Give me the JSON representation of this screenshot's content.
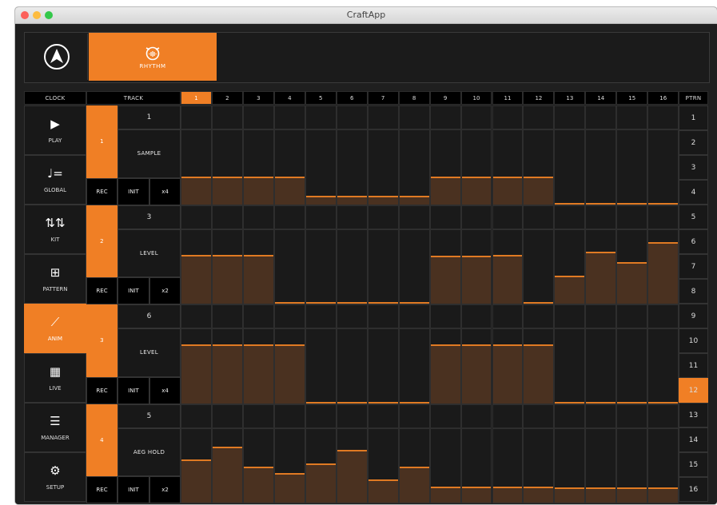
{
  "window": {
    "title": "CraftApp"
  },
  "tabs": {
    "rhythm_label": "RHYTHM"
  },
  "headers": {
    "clock": "CLOCK",
    "track": "TRACK",
    "steps": [
      "1",
      "2",
      "3",
      "4",
      "5",
      "6",
      "7",
      "8",
      "9",
      "10",
      "11",
      "12",
      "13",
      "14",
      "15",
      "16"
    ],
    "active_step": 0,
    "pattern": "PTRN"
  },
  "sidebar": [
    {
      "label": "PLAY",
      "icon": "play-icon",
      "active": false
    },
    {
      "label": "GLOBAL",
      "icon": "tempo-icon",
      "active": false
    },
    {
      "label": "KIT",
      "icon": "sliders-icon",
      "active": false
    },
    {
      "label": "PATTERN",
      "icon": "pattern-icon",
      "active": false
    },
    {
      "label": "ANIM",
      "icon": "anim-icon",
      "active": true
    },
    {
      "label": "LIVE",
      "icon": "grid-icon",
      "active": false
    },
    {
      "label": "MANAGER",
      "icon": "menu-icon",
      "active": false
    },
    {
      "label": "SETUP",
      "icon": "gears-icon",
      "active": false
    }
  ],
  "tracks": [
    {
      "number": "1",
      "param_index": "1",
      "param_name": "SAMPLE",
      "rec": "REC",
      "init": "INIT",
      "mult": "x4",
      "levels": [
        0.37,
        0.37,
        0.37,
        0.37,
        0.1,
        0.1,
        0.1,
        0.1,
        0.37,
        0.37,
        0.37,
        0.37,
        0.0,
        0.0,
        0.0,
        0.0
      ]
    },
    {
      "number": "2",
      "param_index": "3",
      "param_name": "LEVEL",
      "rec": "REC",
      "init": "INIT",
      "mult": "x2",
      "levels": [
        0.65,
        0.65,
        0.65,
        0.0,
        0.0,
        0.0,
        0.0,
        0.0,
        0.64,
        0.64,
        0.65,
        0.0,
        0.37,
        0.7,
        0.55,
        0.83
      ]
    },
    {
      "number": "3",
      "param_index": "6",
      "param_name": "LEVEL",
      "rec": "REC",
      "init": "INIT",
      "mult": "x4",
      "levels": [
        0.8,
        0.8,
        0.8,
        0.8,
        0.0,
        0.0,
        0.0,
        0.0,
        0.8,
        0.8,
        0.8,
        0.8,
        0.0,
        0.0,
        0.0,
        0.0
      ]
    },
    {
      "number": "4",
      "param_index": "5",
      "param_name": "AEG HOLD",
      "rec": "REC",
      "init": "INIT",
      "mult": "x2",
      "levels": [
        0.58,
        0.75,
        0.47,
        0.39,
        0.52,
        0.71,
        0.3,
        0.48,
        0.2,
        0.2,
        0.2,
        0.2,
        0.19,
        0.19,
        0.19,
        0.19
      ]
    }
  ],
  "patterns": {
    "items": [
      "1",
      "2",
      "3",
      "4",
      "5",
      "6",
      "7",
      "8",
      "9",
      "10",
      "11",
      "12",
      "13",
      "14",
      "15",
      "16"
    ],
    "active_index": 11
  },
  "colors": {
    "accent": "#f07f25",
    "fill": "#4a3120",
    "background": "#1f1f1f"
  }
}
